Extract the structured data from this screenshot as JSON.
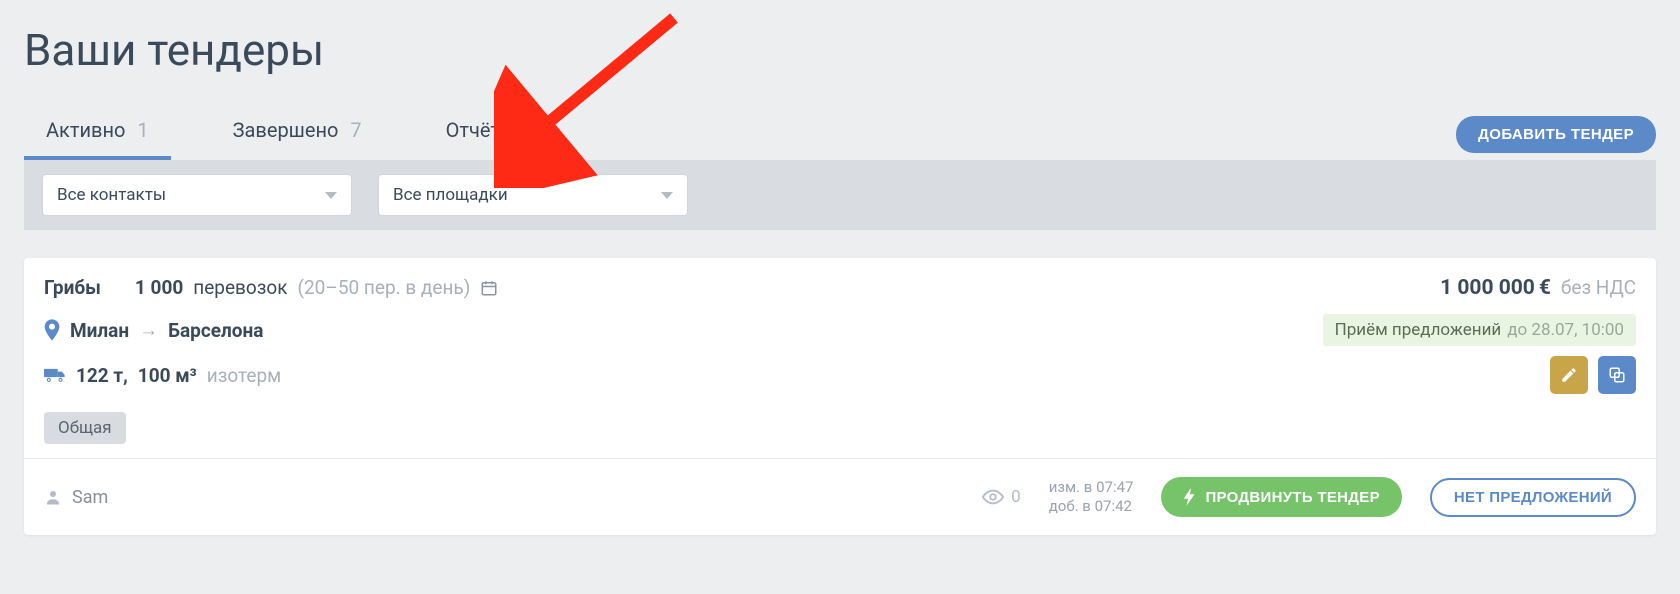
{
  "page_title": "Ваши тендеры",
  "tabs": {
    "active": {
      "label": "Активно",
      "count": "1"
    },
    "done": {
      "label": "Завершено",
      "count": "7"
    },
    "reports": {
      "label": "Отчёты"
    }
  },
  "add_button": "ДОБАВИТЬ ТЕНДЕР",
  "filters": {
    "contacts": "Все контакты",
    "platforms": "Все площадки"
  },
  "tender": {
    "title": "Грибы",
    "shipments_count": "1 000",
    "shipments_suffix": "перевозок",
    "per_day": "(20–50 пер. в день)",
    "price_value": "1 000 000",
    "price_currency": "€",
    "price_vat": "без НДС",
    "route": {
      "from": "Милан",
      "to": "Барселона"
    },
    "status": {
      "label": "Приём предложений",
      "until": "до 28.07, 10:00"
    },
    "vehicle": {
      "weight": "122 т,",
      "volume": "100 м³",
      "type": "изотерм"
    },
    "tag": "Общая",
    "user": "Sam",
    "views": "0",
    "times": {
      "modified": "изм. в 07:47",
      "added": "доб. в 07:42"
    },
    "promote_btn": "ПРОДВИНУТЬ ТЕНДЕР",
    "no_offers_btn": "НЕТ ПРЕДЛОЖЕНИЙ"
  }
}
